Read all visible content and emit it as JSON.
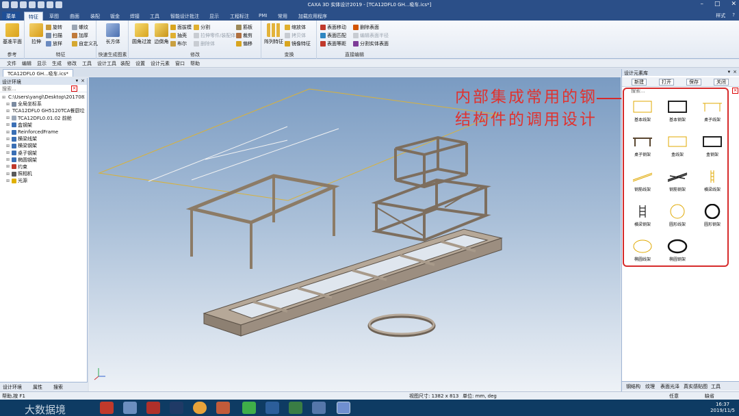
{
  "window": {
    "title": "CAXA 3D 实体设计2019 - [TCA12DFL0 GH...吸车.ics*]",
    "controls": [
      "–",
      "□",
      "✕"
    ]
  },
  "ribbon_tabs": [
    "菜单",
    "特征",
    "草图",
    "曲面",
    "装配",
    "钣金",
    "焊接",
    "工具",
    "智能设计批注",
    "显示",
    "工程标注",
    "PMI",
    "常用",
    "加载应用程序"
  ],
  "ribbon_active_tab": "特征",
  "ribbon_right": {
    "style": "样式",
    "help": "?"
  },
  "ribbon_groups": {
    "reference": {
      "title": "参考",
      "big": "基准平面"
    },
    "feature": {
      "title": "特征",
      "big": "拉伸",
      "items": [
        "旋转",
        "扫描",
        "放样",
        "螺纹",
        "加厚",
        "自定义孔"
      ]
    },
    "quick": {
      "title": "快速生成图素",
      "big": "长方体"
    },
    "modify": {
      "title": "修改",
      "big1": "圆角过渡",
      "big2": "边倒角",
      "items": [
        "面拔模",
        "抽壳",
        "布尔",
        "分割",
        "拉伸零件/装配体",
        "删除体",
        "筋板",
        "裁剪",
        "偏移"
      ]
    },
    "transform": {
      "title": "变换",
      "big": "阵列特征",
      "items": [
        "缩放体",
        "拷贝体",
        "镜像特征"
      ]
    },
    "direct": {
      "title": "直接编辑",
      "items": [
        "表面移动",
        "删除表面",
        "表面匹配",
        "编辑表面半径",
        "表面等距",
        "分割实体表面"
      ]
    }
  },
  "menu": [
    "文件",
    "编辑",
    "显示",
    "生成",
    "修改",
    "工具",
    "设计工具",
    "装配",
    "设置",
    "设计元素",
    "窗口",
    "帮助"
  ],
  "doc_tab": "TCA12DFL0 GH...吸车.ics*",
  "left_panel": {
    "title": "设计环境",
    "search_placeholder": "搜索...",
    "tree": [
      {
        "label": "C:\\Users\\yangl\\Desktop\\20170822",
        "color": "#c0392b",
        "indent": 0
      },
      {
        "label": "全局坐标系",
        "color": "#7a8aa0",
        "indent": 1
      },
      {
        "label": "TCA12DFL0 GH5120TCA餐厨垃圾",
        "color": "#9aa7b8",
        "indent": 1
      },
      {
        "label": "TCA12DFL0.01.02 前舱",
        "color": "#9aa7b8",
        "indent": 1
      },
      {
        "label": "盒钢架",
        "color": "#3a6fb5",
        "indent": 1
      },
      {
        "label": "ReinforcedFrame",
        "color": "#3a6fb5",
        "indent": 1
      },
      {
        "label": "横梁线架",
        "color": "#3a6fb5",
        "indent": 1
      },
      {
        "label": "横梁钢架",
        "color": "#3a6fb5",
        "indent": 1
      },
      {
        "label": "桌子钢架",
        "color": "#3a6fb5",
        "indent": 1
      },
      {
        "label": "椭圆钢架",
        "color": "#3a6fb5",
        "indent": 1
      },
      {
        "label": "约束",
        "color": "#c0392b",
        "indent": 1
      },
      {
        "label": "照相机",
        "color": "#5a5a5a",
        "indent": 1
      },
      {
        "label": "光源",
        "color": "#e0b000",
        "indent": 1
      }
    ],
    "bottom_tabs": [
      "设计环境",
      "属性",
      "搜索"
    ]
  },
  "right_panel": {
    "title": "设计元素库",
    "buttons": [
      "新建",
      "打开",
      "保存",
      "关闭"
    ],
    "search_placeholder": "搜索...",
    "elements": [
      {
        "label": "基本线架",
        "shape": "rect-line"
      },
      {
        "label": "基本钢架",
        "shape": "rect-steel"
      },
      {
        "label": "桌子线架",
        "shape": "table-line"
      },
      {
        "label": "桌子钢架",
        "shape": "table-steel"
      },
      {
        "label": "盒线架",
        "shape": "box-line"
      },
      {
        "label": "盒钢架",
        "shape": "box-steel"
      },
      {
        "label": "钢筋线架",
        "shape": "rebar-line"
      },
      {
        "label": "钢筋钢架",
        "shape": "rebar-steel"
      },
      {
        "label": "横梁线架",
        "shape": "beam-line"
      },
      {
        "label": "横梁钢架",
        "shape": "beam-steel"
      },
      {
        "label": "圆形线架",
        "shape": "circle-line"
      },
      {
        "label": "圆形钢架",
        "shape": "circle-steel"
      },
      {
        "label": "椭圆线架",
        "shape": "ellipse-line"
      },
      {
        "label": "椭圆钢架",
        "shape": "ellipse-steel"
      }
    ],
    "bottom_tabs": [
      "钢结构",
      "纹理",
      "表面光泽",
      "真实感贴图",
      "工具"
    ]
  },
  "annotation": {
    "line1": "内部集成常用的钢",
    "line2": "结构件的调用设计"
  },
  "status": {
    "left": "帮助,按 F1",
    "viewsize": "视图尺寸: 1382 x 813",
    "units": "单位: mm, deg",
    "right1": "任意",
    "right2": "缺省"
  },
  "taskbar": {
    "watermark": "大数据境",
    "time": "16:37",
    "date": "2019/11/5"
  }
}
